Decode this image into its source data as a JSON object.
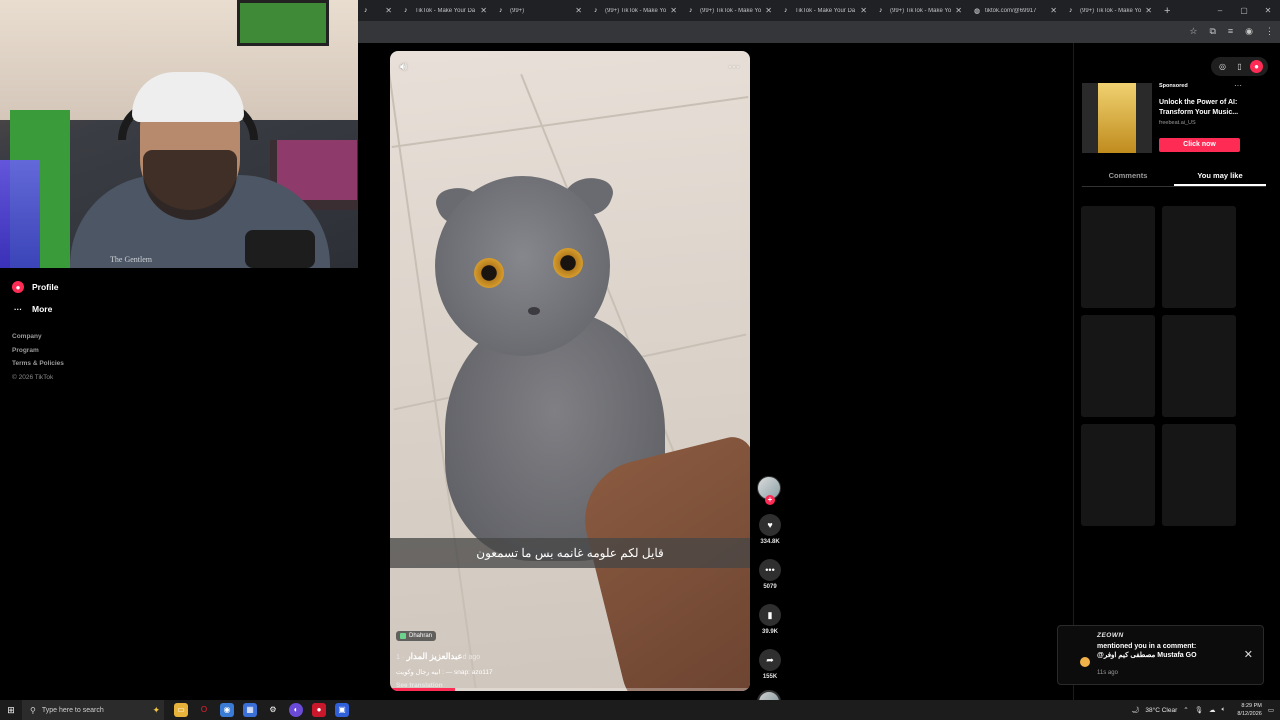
{
  "browser": {
    "tabs": [
      {
        "title": "",
        "icon": "tiktok-icon"
      },
      {
        "title": "TikTok - Make Your Da",
        "icon": "tiktok-icon"
      },
      {
        "title": "(99+)",
        "icon": "tiktok-icon"
      },
      {
        "title": "(99+) TikTok - Make Yo",
        "icon": "tiktok-icon"
      },
      {
        "title": "(99+) TikTok - Make Yo",
        "icon": "tiktok-icon"
      },
      {
        "title": "TikTok - Make Your Da",
        "icon": "tiktok-icon"
      },
      {
        "title": "(99+) TikTok - Make Yo",
        "icon": "tiktok-icon"
      },
      {
        "title": "tiktok.com/@69917",
        "icon": "globe-icon"
      },
      {
        "title": "(99+) TikTok - Make Yo",
        "icon": "tiktok-icon"
      }
    ],
    "new_tab": "+",
    "window_controls": [
      "–",
      "▢",
      "✕"
    ]
  },
  "webcam": {
    "shirt_text": "The Gentlem"
  },
  "nav": {
    "items": [
      {
        "label": "Profile",
        "icon": "profile-icon"
      },
      {
        "label": "More",
        "icon": "more-icon"
      }
    ],
    "footer": {
      "company": "Company",
      "program": "Program",
      "terms": "Terms & Policies",
      "copyright": "© 2026 TikTok"
    }
  },
  "video": {
    "caption": "قايل لكم علومه غانمه بس ما تسمعون",
    "location": "Dhahran",
    "author": "عبدالعزيز المدار",
    "ago": "· 1d ago",
    "description": "ابيه رجال وكويت : — snap: azo117",
    "see_translation": "See translation",
    "progress": 0.18
  },
  "actions": {
    "likes": "334.8K",
    "comments": "5079",
    "saves": "39.9K",
    "shares": "155K"
  },
  "right_panel": {
    "ad": {
      "sponsored": "Sponsored",
      "title": "Unlock the Power of AI: Transform Your Music...",
      "domain": "freebeat.ai_US",
      "cta": "Click now"
    },
    "tabs": [
      {
        "label": "Comments",
        "active": false
      },
      {
        "label": "You may like",
        "active": true
      }
    ]
  },
  "toast": {
    "brand": "ZEOWN",
    "text": "mentioned you in a comment: @مصطفى كيم اوفر Mustafa GO",
    "time": "11s ago"
  },
  "taskbar": {
    "search_placeholder": "Type here to search",
    "weather": "38°C  Clear",
    "time": "8:29 PM",
    "date": "8/12/2026"
  },
  "colors": {
    "accent": "#fe2c55",
    "background": "#000000"
  }
}
